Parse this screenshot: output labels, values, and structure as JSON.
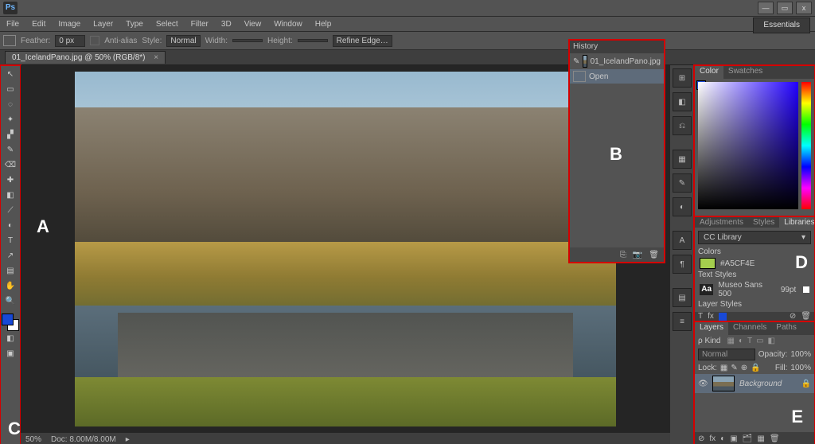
{
  "app": {
    "logo": "Ps"
  },
  "window": {
    "min": "—",
    "max": "▭",
    "close": "x"
  },
  "menu": [
    "File",
    "Edit",
    "Image",
    "Layer",
    "Type",
    "Select",
    "Filter",
    "3D",
    "View",
    "Window",
    "Help"
  ],
  "options": {
    "feather_label": "Feather:",
    "feather": "0 px",
    "anti_alias": "Anti-alias",
    "style_label": "Style:",
    "style": "Normal",
    "width_label": "Width:",
    "height_label": "Height:",
    "refine": "Refine Edge…"
  },
  "workspace": "Essentials",
  "doc_tab": {
    "text": "01_IcelandPano.jpg @ 50% (RGB/8*)",
    "close": "×"
  },
  "status": {
    "zoom": "50%",
    "doc": "Doc: 8.00M/8.00M"
  },
  "tools": [
    "↖",
    "▭",
    "◌",
    "✦",
    "▞",
    "✎",
    "⌫",
    "✚",
    "◧",
    "⟋",
    "◐",
    "T",
    "↗",
    "▤",
    "✋",
    "🔍"
  ],
  "dockstrip": [
    "⊞",
    "◧",
    "⎌",
    "▦",
    "✎",
    "◐",
    "A",
    "¶",
    "▤",
    "≡"
  ],
  "history": {
    "title": "History",
    "doc": "01_IcelandPano.jpg",
    "steps": [
      "Open"
    ],
    "foot": [
      "⎘",
      "📷",
      "🗑"
    ]
  },
  "color_panel": {
    "tabs": [
      "Color",
      "Swatches"
    ],
    "active": 0
  },
  "adjust_panel": {
    "tabs": [
      "Adjustments",
      "Styles",
      "Libraries"
    ],
    "active": 2
  },
  "libraries": {
    "selector": "CC Library",
    "colors_hdr": "Colors",
    "color_value": "#A5CF4E",
    "text_hdr": "Text Styles",
    "text_name": "Museo Sans 500",
    "text_size": "99pt",
    "layer_hdr": "Layer Styles",
    "prop_icons": [
      "T",
      "fx",
      "◪"
    ]
  },
  "layers_panel": {
    "tabs": [
      "Layers",
      "Channels",
      "Paths"
    ],
    "active": 0,
    "kind": "ρ Kind",
    "kind_icons": [
      "▦",
      "◐",
      "T",
      "▭",
      "◧"
    ],
    "mode": "Normal",
    "opacity_label": "Opacity:",
    "opacity": "100%",
    "lock_label": "Lock:",
    "lock_icons": [
      "▦",
      "✎",
      "⊕",
      "🔒"
    ],
    "fill_label": "Fill:",
    "fill": "100%",
    "layer": {
      "name": "Background",
      "locked": "🔒",
      "visible": "👁"
    },
    "foot": [
      "⊘",
      "fx",
      "◐",
      "▣",
      "🗂",
      "▦",
      "🗑"
    ]
  },
  "annot": {
    "A": "A",
    "B": "B",
    "C": "C",
    "D": "D",
    "E": "E"
  }
}
